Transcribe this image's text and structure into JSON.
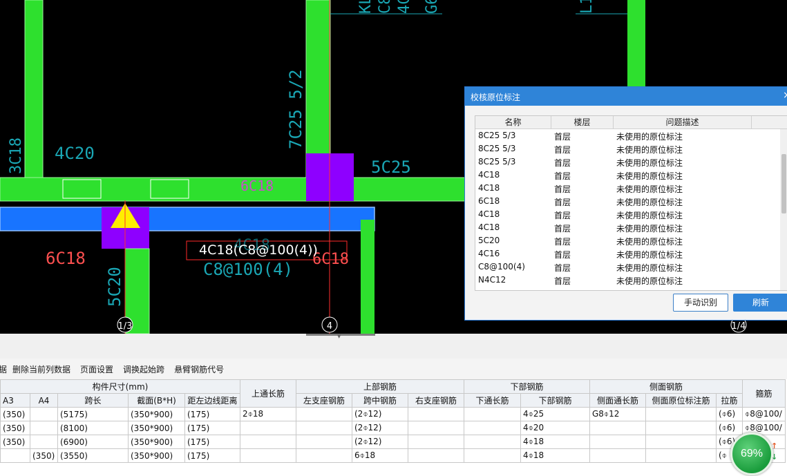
{
  "cad": {
    "labels": {
      "rebar_4c20": "4C20",
      "rebar_3c18": "3C18",
      "rebar_7c25": "7C25 5/2",
      "rebar_5c25": "5C25",
      "rebar_6c18_mid": "6C18",
      "rebar_6c18_left": "6C18",
      "rebar_5c20": "5C20",
      "rebar_4c18_faded": "4C18",
      "rebar_c8_faded": "C8@100(4)",
      "rebar_6c18_right": "6C18",
      "highlight_text": "4C18(C8@100(4))",
      "axis_13": "1/3",
      "axis_4": "4",
      "axis_14": "1/4",
      "top_frag_a": "KL",
      "top_frag_b": "C8",
      "top_frag_c": "4C",
      "top_frag_d": "G6",
      "top_frag_e": "L1"
    },
    "colors": {
      "column_green": "#2ee02e",
      "beam_blue": "#1874ff",
      "joint_purple": "#8e00ff",
      "marker_yellow": "#ffee00",
      "cyan_text": "#1aa7b5",
      "red_text": "#ff5050",
      "magenta_text": "#c850c8"
    }
  },
  "toolbar": {
    "items": [
      "据",
      "删除当前列数据",
      "页面设置",
      "调换起始跨",
      "悬臂钢筋代号"
    ]
  },
  "grid": {
    "group_headers": {
      "size": "构件尺寸(mm)",
      "top_through": "上通长筋",
      "top_rebar": "上部钢筋",
      "bottom_rebar": "下部钢筋",
      "side_rebar": "侧面钢筋",
      "stirrup": "箍筋"
    },
    "sub_headers": {
      "a3": "A3",
      "a4": "A4",
      "span": "跨长",
      "section": "截面(B*H)",
      "edge_dist": "距左边线距离",
      "left_support": "左支座钢筋",
      "mid_span": "跨中钢筋",
      "right_support": "右支座钢筋",
      "bottom_through": "下通长筋",
      "bottom_rebar": "下部钢筋",
      "side_through": "侧面通长筋",
      "side_inplace": "侧面原位标注筋",
      "tie": "拉筋"
    },
    "rows": [
      {
        "a3": "(350)",
        "a4": "",
        "span": "(5175)",
        "section": "(350*900)",
        "edge": "(175)",
        "top_through": "2⌽18",
        "left": "",
        "mid": "(2⌽12)",
        "right": "",
        "bot_through": "",
        "bottom": "4⌽25",
        "side_through": "G8⌽12",
        "side_inplace": "",
        "tie": "(⌽6)",
        "stirrup": "⌽8@100/"
      },
      {
        "a3": "(350)",
        "a4": "",
        "span": "(8100)",
        "section": "(350*900)",
        "edge": "(175)",
        "top_through": "",
        "left": "",
        "mid": "(2⌽12)",
        "right": "",
        "bot_through": "",
        "bottom": "4⌽20",
        "side_through": "",
        "side_inplace": "",
        "tie": "(⌽6)",
        "stirrup": "⌽8@100/"
      },
      {
        "a3": "(350)",
        "a4": "",
        "span": "(6900)",
        "section": "(350*900)",
        "edge": "(175)",
        "top_through": "",
        "left": "",
        "mid": "(2⌽12)",
        "right": "",
        "bot_through": "",
        "bottom": "4⌽18",
        "side_through": "",
        "side_inplace": "",
        "tie": "(⌽6)",
        "stirrup": ""
      },
      {
        "a3": "",
        "a4": "(350)",
        "span": "(3550)",
        "section": "(350*900)",
        "edge": "(175)",
        "top_through": "",
        "left": "",
        "mid": "6⌽18",
        "right": "",
        "bot_through": "",
        "bottom": "4⌽18",
        "side_through": "",
        "side_inplace": "",
        "tie": "(⌽",
        "stirrup": ""
      }
    ]
  },
  "dialog": {
    "title": "校核原位标注",
    "close_glyph": "×",
    "columns": [
      "名称",
      "楼层",
      "问题描述"
    ],
    "rows": [
      {
        "name": "8C25 5/3",
        "floor": "首层",
        "desc": "未使用的原位标注"
      },
      {
        "name": "8C25 5/3",
        "floor": "首层",
        "desc": "未使用的原位标注"
      },
      {
        "name": "8C25 5/3",
        "floor": "首层",
        "desc": "未使用的原位标注"
      },
      {
        "name": "4C18",
        "floor": "首层",
        "desc": "未使用的原位标注"
      },
      {
        "name": "4C18",
        "floor": "首层",
        "desc": "未使用的原位标注"
      },
      {
        "name": "6C18",
        "floor": "首层",
        "desc": "未使用的原位标注"
      },
      {
        "name": "4C18",
        "floor": "首层",
        "desc": "未使用的原位标注"
      },
      {
        "name": "4C18",
        "floor": "首层",
        "desc": "未使用的原位标注"
      },
      {
        "name": "5C20",
        "floor": "首层",
        "desc": "未使用的原位标注"
      },
      {
        "name": "4C16",
        "floor": "首层",
        "desc": "未使用的原位标注"
      },
      {
        "name": "C8@100(4)",
        "floor": "首层",
        "desc": "未使用的原位标注"
      },
      {
        "name": "N4C12",
        "floor": "首层",
        "desc": "未使用的原位标注"
      }
    ],
    "manual_button": "手动识别",
    "refresh_button": "刷新"
  },
  "progress": {
    "value_text": "69%",
    "value": 69
  }
}
